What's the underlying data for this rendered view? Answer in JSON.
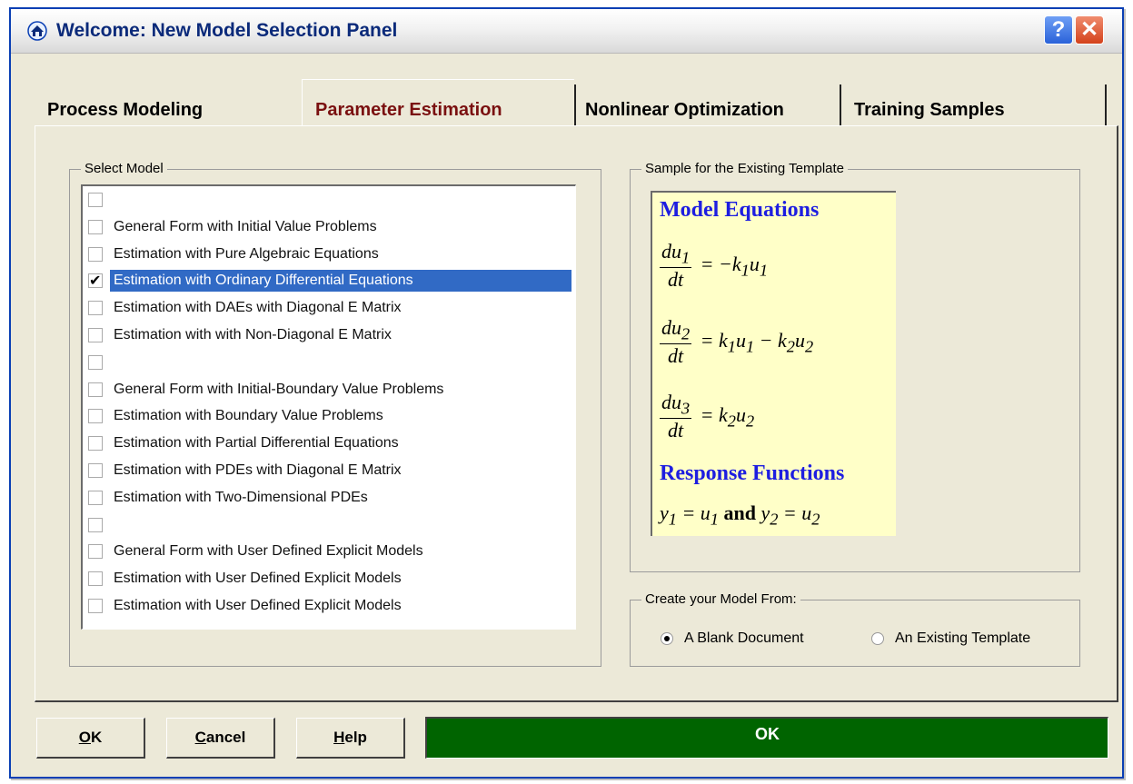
{
  "window": {
    "title": "Welcome:  New Model Selection Panel"
  },
  "title_buttons": {
    "help": "?",
    "close": "✕"
  },
  "tabs": [
    {
      "label": "Process Modeling",
      "selected": false
    },
    {
      "label": "Parameter Estimation",
      "selected": true
    },
    {
      "label": "Nonlinear Optimization",
      "selected": false
    },
    {
      "label": "Training Samples",
      "selected": false
    }
  ],
  "select_model": {
    "label": "Select Model",
    "items": [
      {
        "label": "",
        "checked": false
      },
      {
        "label": "General Form with Initial Value Problems",
        "checked": false
      },
      {
        "label": "Estimation with Pure Algebraic Equations",
        "checked": false
      },
      {
        "label": "Estimation with Ordinary Differential Equations",
        "checked": true
      },
      {
        "label": "Estimation with DAEs with Diagonal E Matrix",
        "checked": false
      },
      {
        "label": "Estimation with with Non-Diagonal E Matrix",
        "checked": false
      },
      {
        "label": "",
        "checked": false
      },
      {
        "label": "General Form with Initial-Boundary Value Problems",
        "checked": false
      },
      {
        "label": "Estimation with Boundary Value Problems",
        "checked": false
      },
      {
        "label": "Estimation with Partial Differential Equations",
        "checked": false
      },
      {
        "label": "Estimation with PDEs with Diagonal E Matrix",
        "checked": false
      },
      {
        "label": "Estimation with Two-Dimensional PDEs",
        "checked": false
      },
      {
        "label": "",
        "checked": false
      },
      {
        "label": "General Form with User Defined Explicit Models",
        "checked": false
      },
      {
        "label": "Estimation with User Defined Explicit Models",
        "checked": false
      },
      {
        "label": "Estimation with User Defined Explicit Models",
        "checked": false
      }
    ]
  },
  "sample": {
    "label": "Sample for the Existing Template",
    "model_heading": "Model Equations",
    "response_heading": "Response Functions",
    "eq1": {
      "num": "du",
      "num_sub": "1",
      "den": "dt",
      "rhs": "= −k",
      "rhs_parts": [
        "= −",
        "k",
        "1",
        "u",
        "1"
      ]
    },
    "eq2": {
      "num": "du",
      "num_sub": "2",
      "den": "dt",
      "rhs_parts": [
        "= ",
        "k",
        "1",
        "u",
        "1",
        " − ",
        "k",
        "2",
        "u",
        "2"
      ]
    },
    "eq3": {
      "num": "du",
      "num_sub": "3",
      "den": "dt",
      "rhs_parts": [
        "= ",
        "k",
        "2",
        "u",
        "2"
      ]
    },
    "response": {
      "y1": "y",
      "y1_sub": "1",
      "eq1": "= u",
      "eq1_sub": "1",
      "and": "and",
      "y2": "y",
      "y2_sub": "2",
      "eq2": "= u",
      "eq2_sub": "2"
    }
  },
  "create_from": {
    "label": "Create your Model From:",
    "options": [
      {
        "label": "A Blank Document",
        "selected": true
      },
      {
        "label": "An Existing Template",
        "selected": false
      }
    ]
  },
  "buttons": {
    "ok": {
      "accel": "O",
      "rest": "K"
    },
    "cancel": {
      "accel": "C",
      "rest": "ancel"
    },
    "help": {
      "accel": "H",
      "rest": "elp"
    }
  },
  "status": "OK"
}
